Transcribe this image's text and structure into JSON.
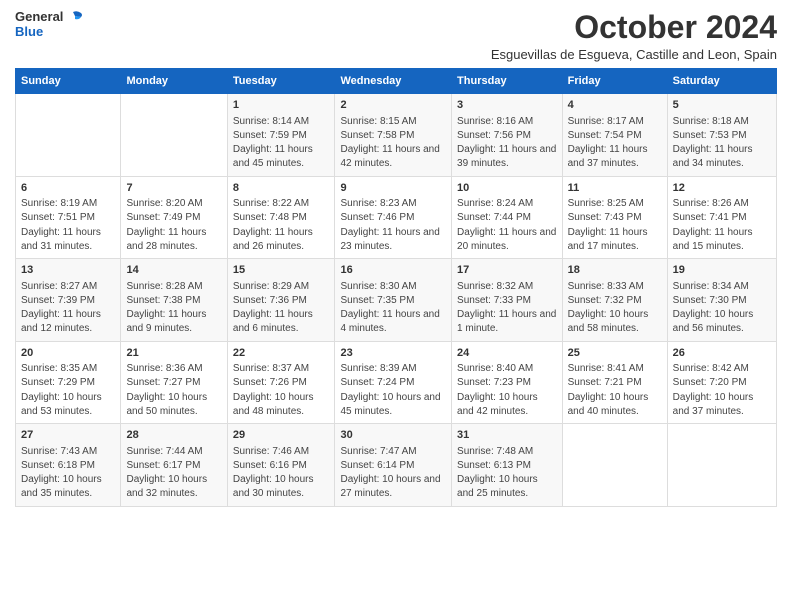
{
  "logo": {
    "general": "General",
    "blue": "Blue"
  },
  "title": "October 2024",
  "subtitle": "Esguevillas de Esgueva, Castille and Leon, Spain",
  "days_of_week": [
    "Sunday",
    "Monday",
    "Tuesday",
    "Wednesday",
    "Thursday",
    "Friday",
    "Saturday"
  ],
  "weeks": [
    [
      {
        "day": "",
        "sunrise": "",
        "sunset": "",
        "daylight": ""
      },
      {
        "day": "",
        "sunrise": "",
        "sunset": "",
        "daylight": ""
      },
      {
        "day": "1",
        "sunrise": "Sunrise: 8:14 AM",
        "sunset": "Sunset: 7:59 PM",
        "daylight": "Daylight: 11 hours and 45 minutes."
      },
      {
        "day": "2",
        "sunrise": "Sunrise: 8:15 AM",
        "sunset": "Sunset: 7:58 PM",
        "daylight": "Daylight: 11 hours and 42 minutes."
      },
      {
        "day": "3",
        "sunrise": "Sunrise: 8:16 AM",
        "sunset": "Sunset: 7:56 PM",
        "daylight": "Daylight: 11 hours and 39 minutes."
      },
      {
        "day": "4",
        "sunrise": "Sunrise: 8:17 AM",
        "sunset": "Sunset: 7:54 PM",
        "daylight": "Daylight: 11 hours and 37 minutes."
      },
      {
        "day": "5",
        "sunrise": "Sunrise: 8:18 AM",
        "sunset": "Sunset: 7:53 PM",
        "daylight": "Daylight: 11 hours and 34 minutes."
      }
    ],
    [
      {
        "day": "6",
        "sunrise": "Sunrise: 8:19 AM",
        "sunset": "Sunset: 7:51 PM",
        "daylight": "Daylight: 11 hours and 31 minutes."
      },
      {
        "day": "7",
        "sunrise": "Sunrise: 8:20 AM",
        "sunset": "Sunset: 7:49 PM",
        "daylight": "Daylight: 11 hours and 28 minutes."
      },
      {
        "day": "8",
        "sunrise": "Sunrise: 8:22 AM",
        "sunset": "Sunset: 7:48 PM",
        "daylight": "Daylight: 11 hours and 26 minutes."
      },
      {
        "day": "9",
        "sunrise": "Sunrise: 8:23 AM",
        "sunset": "Sunset: 7:46 PM",
        "daylight": "Daylight: 11 hours and 23 minutes."
      },
      {
        "day": "10",
        "sunrise": "Sunrise: 8:24 AM",
        "sunset": "Sunset: 7:44 PM",
        "daylight": "Daylight: 11 hours and 20 minutes."
      },
      {
        "day": "11",
        "sunrise": "Sunrise: 8:25 AM",
        "sunset": "Sunset: 7:43 PM",
        "daylight": "Daylight: 11 hours and 17 minutes."
      },
      {
        "day": "12",
        "sunrise": "Sunrise: 8:26 AM",
        "sunset": "Sunset: 7:41 PM",
        "daylight": "Daylight: 11 hours and 15 minutes."
      }
    ],
    [
      {
        "day": "13",
        "sunrise": "Sunrise: 8:27 AM",
        "sunset": "Sunset: 7:39 PM",
        "daylight": "Daylight: 11 hours and 12 minutes."
      },
      {
        "day": "14",
        "sunrise": "Sunrise: 8:28 AM",
        "sunset": "Sunset: 7:38 PM",
        "daylight": "Daylight: 11 hours and 9 minutes."
      },
      {
        "day": "15",
        "sunrise": "Sunrise: 8:29 AM",
        "sunset": "Sunset: 7:36 PM",
        "daylight": "Daylight: 11 hours and 6 minutes."
      },
      {
        "day": "16",
        "sunrise": "Sunrise: 8:30 AM",
        "sunset": "Sunset: 7:35 PM",
        "daylight": "Daylight: 11 hours and 4 minutes."
      },
      {
        "day": "17",
        "sunrise": "Sunrise: 8:32 AM",
        "sunset": "Sunset: 7:33 PM",
        "daylight": "Daylight: 11 hours and 1 minute."
      },
      {
        "day": "18",
        "sunrise": "Sunrise: 8:33 AM",
        "sunset": "Sunset: 7:32 PM",
        "daylight": "Daylight: 10 hours and 58 minutes."
      },
      {
        "day": "19",
        "sunrise": "Sunrise: 8:34 AM",
        "sunset": "Sunset: 7:30 PM",
        "daylight": "Daylight: 10 hours and 56 minutes."
      }
    ],
    [
      {
        "day": "20",
        "sunrise": "Sunrise: 8:35 AM",
        "sunset": "Sunset: 7:29 PM",
        "daylight": "Daylight: 10 hours and 53 minutes."
      },
      {
        "day": "21",
        "sunrise": "Sunrise: 8:36 AM",
        "sunset": "Sunset: 7:27 PM",
        "daylight": "Daylight: 10 hours and 50 minutes."
      },
      {
        "day": "22",
        "sunrise": "Sunrise: 8:37 AM",
        "sunset": "Sunset: 7:26 PM",
        "daylight": "Daylight: 10 hours and 48 minutes."
      },
      {
        "day": "23",
        "sunrise": "Sunrise: 8:39 AM",
        "sunset": "Sunset: 7:24 PM",
        "daylight": "Daylight: 10 hours and 45 minutes."
      },
      {
        "day": "24",
        "sunrise": "Sunrise: 8:40 AM",
        "sunset": "Sunset: 7:23 PM",
        "daylight": "Daylight: 10 hours and 42 minutes."
      },
      {
        "day": "25",
        "sunrise": "Sunrise: 8:41 AM",
        "sunset": "Sunset: 7:21 PM",
        "daylight": "Daylight: 10 hours and 40 minutes."
      },
      {
        "day": "26",
        "sunrise": "Sunrise: 8:42 AM",
        "sunset": "Sunset: 7:20 PM",
        "daylight": "Daylight: 10 hours and 37 minutes."
      }
    ],
    [
      {
        "day": "27",
        "sunrise": "Sunrise: 7:43 AM",
        "sunset": "Sunset: 6:18 PM",
        "daylight": "Daylight: 10 hours and 35 minutes."
      },
      {
        "day": "28",
        "sunrise": "Sunrise: 7:44 AM",
        "sunset": "Sunset: 6:17 PM",
        "daylight": "Daylight: 10 hours and 32 minutes."
      },
      {
        "day": "29",
        "sunrise": "Sunrise: 7:46 AM",
        "sunset": "Sunset: 6:16 PM",
        "daylight": "Daylight: 10 hours and 30 minutes."
      },
      {
        "day": "30",
        "sunrise": "Sunrise: 7:47 AM",
        "sunset": "Sunset: 6:14 PM",
        "daylight": "Daylight: 10 hours and 27 minutes."
      },
      {
        "day": "31",
        "sunrise": "Sunrise: 7:48 AM",
        "sunset": "Sunset: 6:13 PM",
        "daylight": "Daylight: 10 hours and 25 minutes."
      },
      {
        "day": "",
        "sunrise": "",
        "sunset": "",
        "daylight": ""
      },
      {
        "day": "",
        "sunrise": "",
        "sunset": "",
        "daylight": ""
      }
    ]
  ]
}
